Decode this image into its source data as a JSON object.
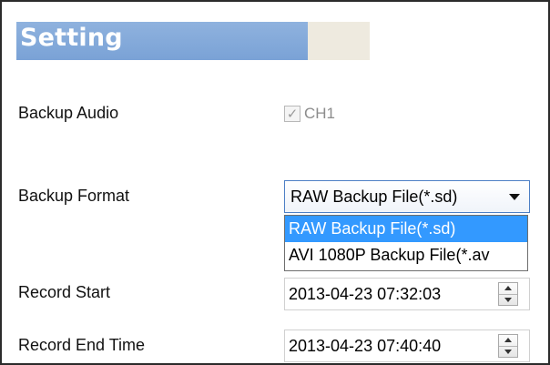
{
  "header": {
    "title": "Setting"
  },
  "backup_audio": {
    "label": "Backup Audio",
    "channel_label": "CH1",
    "checked": true,
    "disabled": true
  },
  "backup_format": {
    "label": "Backup Format",
    "selected": "RAW Backup File(*.sd)",
    "options": [
      "RAW Backup File(*.sd)",
      "AVI 1080P Backup File(*.av"
    ]
  },
  "record_start": {
    "label": "Record Start",
    "value": "2013-04-23 07:32:03"
  },
  "record_end": {
    "label": "Record End Time",
    "value": "2013-04-23 07:40:40"
  },
  "colors": {
    "header_blue": "#7aa2d6",
    "selection": "#3399ff"
  }
}
